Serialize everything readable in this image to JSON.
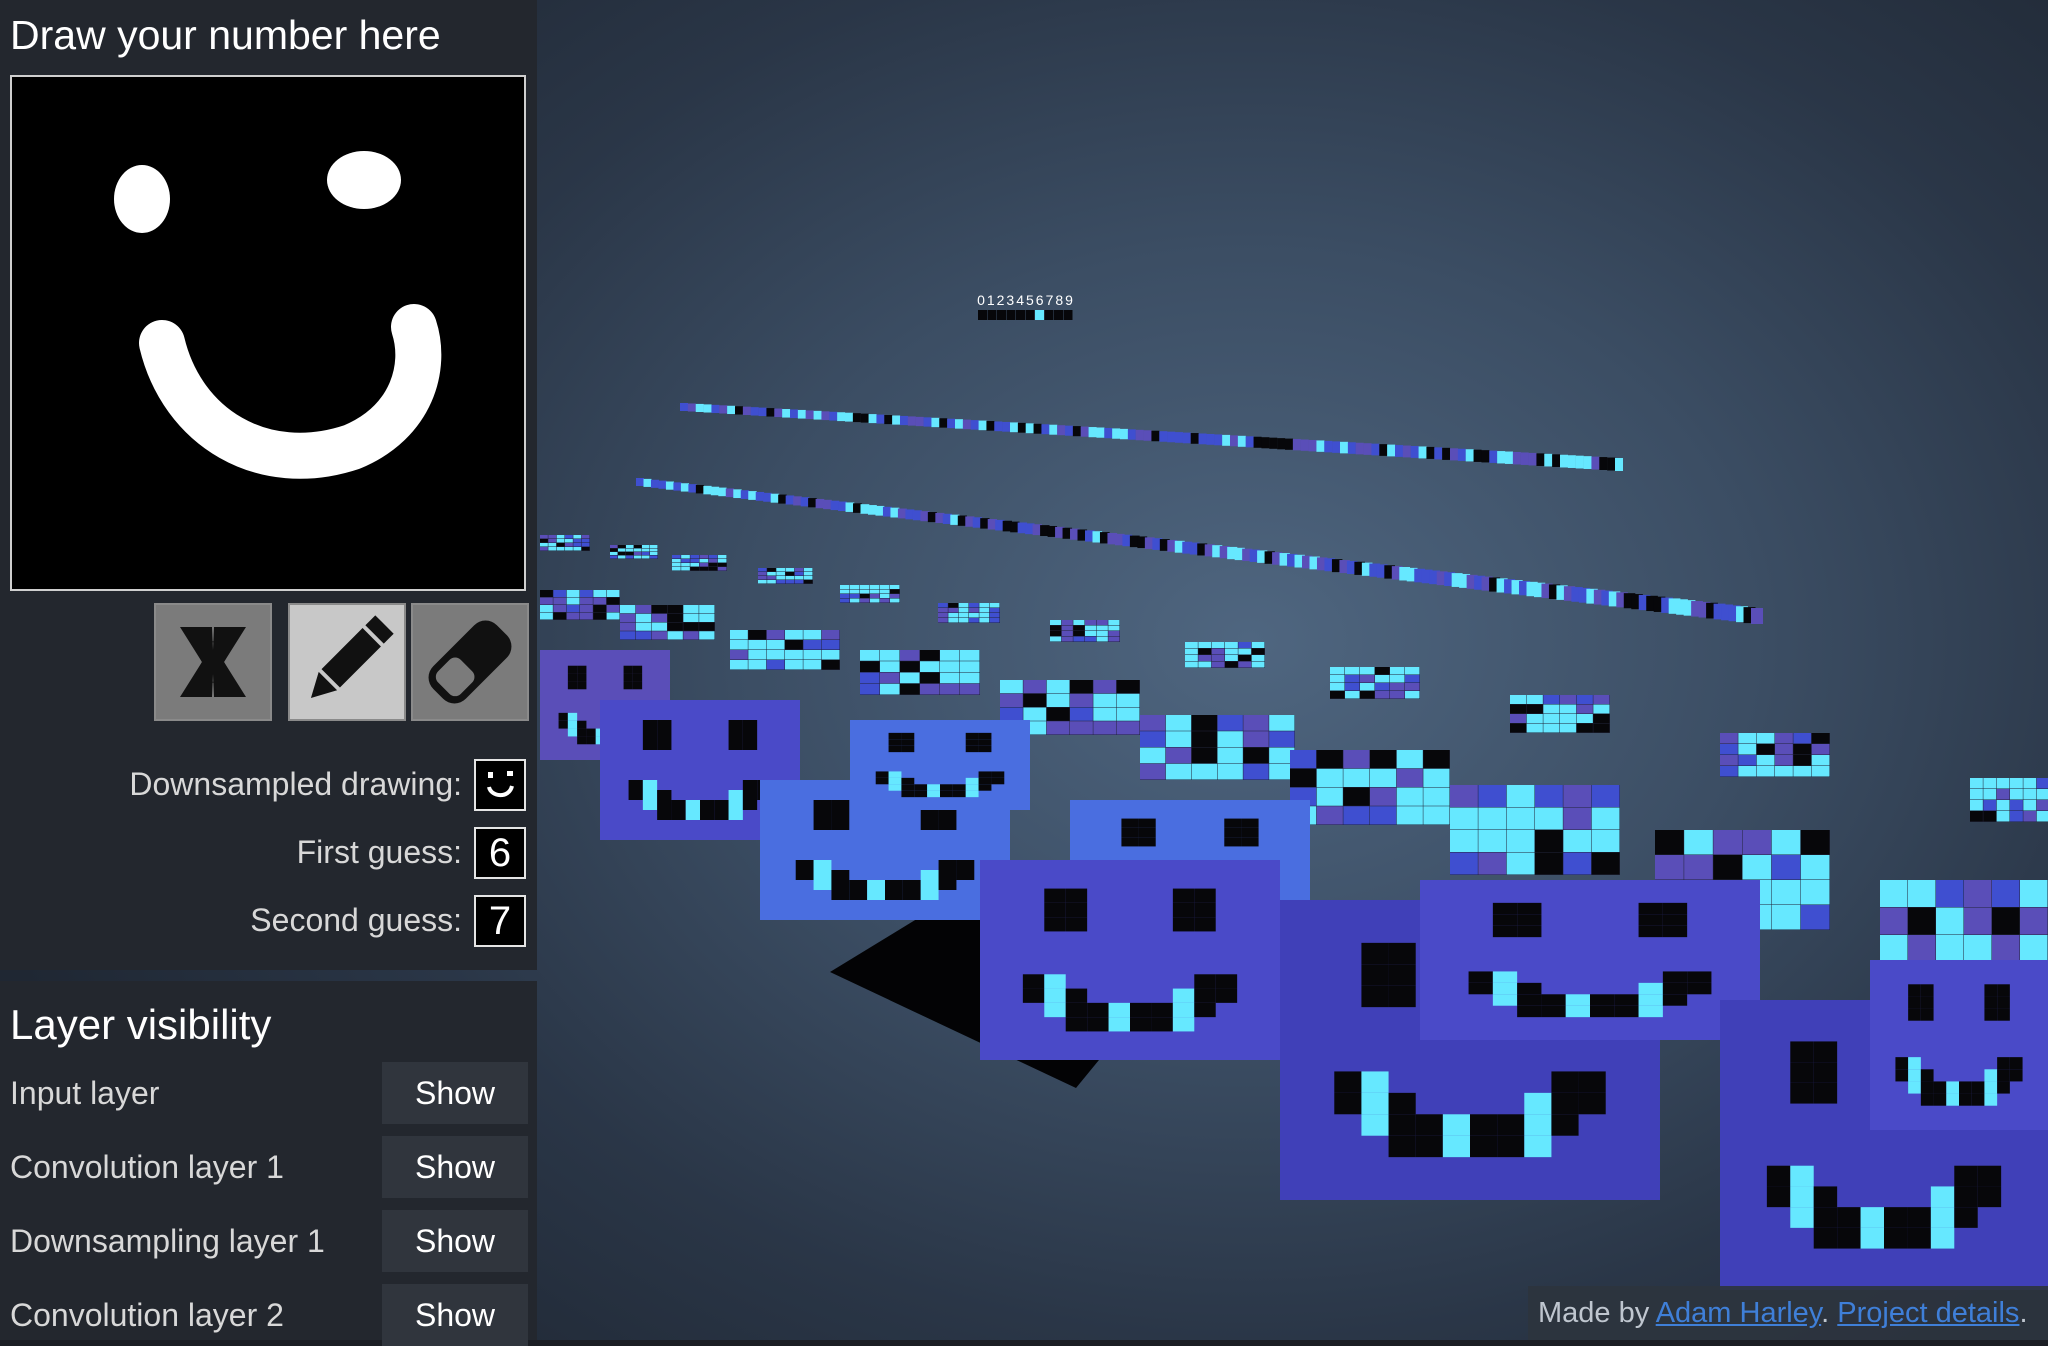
{
  "draw_panel": {
    "title": "Draw your number here",
    "tools": {
      "clear_icon": "clear-x-icon",
      "pencil_icon": "pencil-icon",
      "eraser_icon": "eraser-icon",
      "active_tool": "pencil"
    },
    "downsampled_label": "Downsampled drawing:",
    "first_guess_label": "First guess:",
    "first_guess_value": "6",
    "second_guess_label": "Second guess:",
    "second_guess_value": "7"
  },
  "layer_panel": {
    "title": "Layer visibility",
    "rows": [
      {
        "label": "Input layer",
        "button": "Show"
      },
      {
        "label": "Convolution layer 1",
        "button": "Show"
      },
      {
        "label": "Downsampling layer 1",
        "button": "Show"
      },
      {
        "label": "Convolution layer 2",
        "button": "Show"
      }
    ]
  },
  "visualization": {
    "output_digits": "0123456789",
    "colors": {
      "cyan": "#66e8ff",
      "blue": "#3f4fd0",
      "purple": "#5a4eb8",
      "black": "#07070a"
    }
  },
  "credits": {
    "prefix": "Made by ",
    "author": "Adam Harley",
    "separator": ". ",
    "details": "Project details",
    "suffix": "."
  }
}
